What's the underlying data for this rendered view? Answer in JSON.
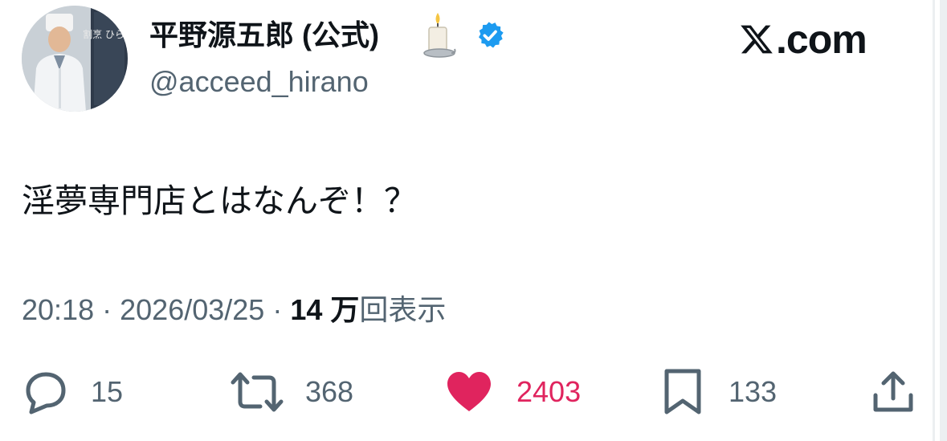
{
  "tweet": {
    "author": {
      "display_name": "平野源五郎 (公式)",
      "handle": "@acceed_hirano",
      "verified": true,
      "name_emoji": "candle-icon",
      "avatar_sign_text": "割烹 ひらの"
    },
    "site_label": ".com",
    "text": "淫夢専門店とはなんぞ！？",
    "time": "20:18",
    "date": "2026/03/25",
    "separator": "·",
    "views_count": "14 万",
    "views_label": "回表示",
    "metrics": {
      "replies": "15",
      "reposts": "368",
      "likes": "2403",
      "bookmarks": "133"
    }
  },
  "colors": {
    "text": "#0f1419",
    "secondary": "#536471",
    "verified": "#1d9bf0",
    "like": "#e0245e"
  }
}
